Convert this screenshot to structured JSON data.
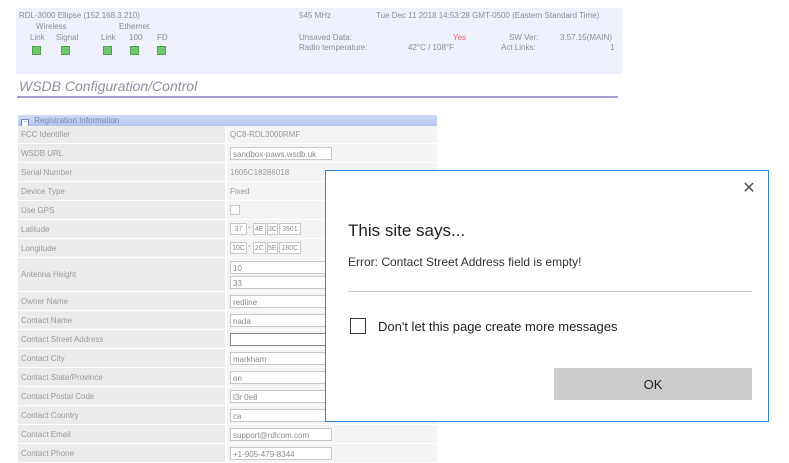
{
  "statusbar": {
    "device": "RDL-3000 Ellipse (152.168.3.210)",
    "frequency": "545 MHz",
    "datetime": "Tue Dec 11 2018 14:53:28 GMT-0500 (Eastern Standard Time)",
    "wireless_label": "Wireless",
    "ethernet_label": "Ethernet",
    "link_label": "Link",
    "signal_label": "Signal",
    "eth_link_label": "Link",
    "eth_100_label": "100",
    "eth_fd_label": "FD",
    "unsaved_label": "Unsaved Data:",
    "unsaved_value": "Yes",
    "radio_temp_label": "Radio temperature:",
    "radio_temp_value": "42°C / 108°F",
    "sw_ver_label": "SW Ver:",
    "sw_ver_value": "3.57.15(MAIN)",
    "act_links_label": "Act Links:",
    "act_links_value": "1"
  },
  "page": {
    "title": "WSDB Configuration/Control"
  },
  "section": {
    "toggle": "−",
    "title": "Registration Information"
  },
  "rows": {
    "fcc_id": {
      "label": "FCC Identifier",
      "value": "QC8-RDL3000RMF"
    },
    "wsdb_url": {
      "label": "WSDB URL",
      "value": "sandbox-paws.wsdb.uk"
    },
    "serial": {
      "label": "Serial Number",
      "value": "1605C18286018"
    },
    "device_type": {
      "label": "Device Type",
      "value": "Fixed"
    },
    "use_gps": {
      "label": "Use GPS"
    },
    "latitude": {
      "label": "Latitude",
      "deg": "37",
      "min": "4E",
      "sec": "3C",
      "frac": "3501"
    },
    "longitude": {
      "label": "Longitude",
      "deg": "10C",
      "min": "2C",
      "sec": "5E",
      "frac": "180C"
    },
    "antenna": {
      "label": "Antenna Height",
      "value1": "10",
      "value2": "33"
    },
    "owner": {
      "label": "Owner Name",
      "value": "redline"
    },
    "contact_name": {
      "label": "Contact Name",
      "value": "nada"
    },
    "street": {
      "label": "Contact Street Address",
      "value": ""
    },
    "city": {
      "label": "Contact City",
      "value": "markham"
    },
    "state": {
      "label": "Contact State/Province",
      "value": "on"
    },
    "postal": {
      "label": "Contact Postal Code",
      "value": "l3r 0e8"
    },
    "country": {
      "label": "Contact Country",
      "value": "ca"
    },
    "email": {
      "label": "Contact Email",
      "value": "support@rdlcom.com"
    },
    "phone": {
      "label": "Contact Phone",
      "value": "+1-905-479-8344"
    }
  },
  "dialog": {
    "close_glyph": "✕",
    "title": "This site says...",
    "message": "Error: Contact Street Address field is empty!",
    "checkbox_label": "Don't let this page create more messages",
    "ok_label": "OK"
  },
  "colors": {
    "statusbar_bg": "#eef0fb",
    "led_green": "#6fc86f",
    "dialog_border": "#2f86d6",
    "ok_button_bg": "#cccccc",
    "title_rule": "#a39fd4"
  }
}
